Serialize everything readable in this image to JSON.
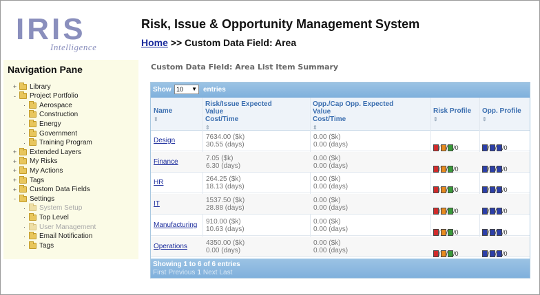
{
  "logo": {
    "name": "IRIS",
    "tagline": "Intelligence"
  },
  "app": {
    "title": "Risk, Issue & Opportunity Management System"
  },
  "breadcrumb": {
    "home": "Home",
    "separator": ">>",
    "current": "Custom Data Field: Area"
  },
  "nav": {
    "title": "Navigation Pane",
    "items": [
      {
        "label": "Library",
        "dim": false
      },
      {
        "label": "Project Portfolio",
        "dim": false
      },
      {
        "label": "Aerospace",
        "dim": false
      },
      {
        "label": "Construction",
        "dim": false
      },
      {
        "label": "Energy",
        "dim": false
      },
      {
        "label": "Government",
        "dim": false
      },
      {
        "label": "Training Program",
        "dim": false
      },
      {
        "label": "Extended Layers",
        "dim": false
      },
      {
        "label": "My Risks",
        "dim": false
      },
      {
        "label": "My Actions",
        "dim": false
      },
      {
        "label": "Tags",
        "dim": false
      },
      {
        "label": "Custom Data Fields",
        "dim": false
      },
      {
        "label": "Settings",
        "dim": false
      },
      {
        "label": "System Setup",
        "dim": true
      },
      {
        "label": "Top Level",
        "dim": false
      },
      {
        "label": "User Management",
        "dim": true
      },
      {
        "label": "Email Notification",
        "dim": false
      },
      {
        "label": "Tags",
        "dim": false
      }
    ]
  },
  "summary": {
    "title": "Custom Data Field: Area List Item Summary"
  },
  "table": {
    "show_label": "Show",
    "page_size": "10",
    "entries_label": "entries",
    "headers": {
      "name": "Name",
      "risk_line1": "Risk/Issue Expected",
      "risk_line2": "Value",
      "risk_line3": "Cost/Time",
      "opp_line1": "Opp./Cap Opp. Expected",
      "opp_line2": "Value",
      "opp_line3": "Cost/Time",
      "risk_profile": "Risk Profile",
      "opp_profile": "Opp. Profile"
    },
    "rows": [
      {
        "name": "Design",
        "risk_cost": "7634.00 ($k)",
        "risk_time": "30.55 (days)",
        "opp_cost": "0.00 ($k)",
        "opp_time": "0.00 (days)",
        "risk_profile": [
          {
            "c": "red",
            "v": "3"
          },
          {
            "c": "orange",
            "v": "3"
          },
          {
            "c": "green",
            "v": "1"
          }
        ],
        "risk_tail": "0",
        "opp_profile": [
          {
            "c": "blue",
            "v": "0"
          },
          {
            "c": "blue",
            "v": "2"
          },
          {
            "c": "blue",
            "v": "0"
          }
        ],
        "opp_tail": "0"
      },
      {
        "name": "Finance",
        "risk_cost": "7.05 ($k)",
        "risk_time": "6.30 (days)",
        "opp_cost": "0.00 ($k)",
        "opp_time": "0.00 (days)",
        "risk_profile": [
          {
            "c": "red",
            "v": "1"
          },
          {
            "c": "orange",
            "v": "1"
          },
          {
            "c": "green",
            "v": "0"
          }
        ],
        "risk_tail": "0",
        "opp_profile": [
          {
            "c": "blue",
            "v": "0"
          },
          {
            "c": "blue",
            "v": "0"
          },
          {
            "c": "blue",
            "v": "0"
          }
        ],
        "opp_tail": "0"
      },
      {
        "name": "HR",
        "risk_cost": "264.25 ($k)",
        "risk_time": "18.13 (days)",
        "opp_cost": "0.00 ($k)",
        "opp_time": "0.00 (days)",
        "risk_profile": [
          {
            "c": "red",
            "v": "1"
          },
          {
            "c": "orange",
            "v": "1"
          },
          {
            "c": "green",
            "v": "1"
          }
        ],
        "risk_tail": "0",
        "opp_profile": [
          {
            "c": "blue",
            "v": "0"
          },
          {
            "c": "blue",
            "v": "1"
          },
          {
            "c": "blue",
            "v": "0"
          }
        ],
        "opp_tail": "0"
      },
      {
        "name": "IT",
        "risk_cost": "1537.50 ($k)",
        "risk_time": "28.88 (days)",
        "opp_cost": "0.00 ($k)",
        "opp_time": "0.00 (days)",
        "risk_profile": [
          {
            "c": "red",
            "v": "3"
          },
          {
            "c": "orange",
            "v": "0"
          },
          {
            "c": "green",
            "v": "0"
          }
        ],
        "risk_tail": "0",
        "opp_profile": [
          {
            "c": "blue",
            "v": "0"
          },
          {
            "c": "blue",
            "v": "1"
          },
          {
            "c": "blue",
            "v": "0"
          }
        ],
        "opp_tail": "0"
      },
      {
        "name": "Manufacturing",
        "risk_cost": "910.00 ($k)",
        "risk_time": "10.63 (days)",
        "opp_cost": "0.00 ($k)",
        "opp_time": "0.00 (days)",
        "risk_profile": [
          {
            "c": "red",
            "v": "1"
          },
          {
            "c": "orange",
            "v": "1"
          },
          {
            "c": "green",
            "v": "2"
          }
        ],
        "risk_tail": "0",
        "opp_profile": [
          {
            "c": "blue",
            "v": "0"
          },
          {
            "c": "blue",
            "v": "2"
          },
          {
            "c": "blue",
            "v": "0"
          }
        ],
        "opp_tail": "0"
      },
      {
        "name": "Operations",
        "risk_cost": "4350.00 ($k)",
        "risk_time": "0.00 (days)",
        "opp_cost": "0.00 ($k)",
        "opp_time": "0.00 (days)",
        "risk_profile": [
          {
            "c": "red",
            "v": "2"
          },
          {
            "c": "orange",
            "v": "2"
          },
          {
            "c": "green",
            "v": "0"
          }
        ],
        "risk_tail": "0",
        "opp_profile": [
          {
            "c": "blue",
            "v": "0"
          },
          {
            "c": "blue",
            "v": "2"
          },
          {
            "c": "blue",
            "v": "0"
          }
        ],
        "opp_tail": "0"
      }
    ],
    "info": "Showing 1 to 6 of 6 entries",
    "pager": {
      "first": "First",
      "previous": "Previous",
      "page": "1",
      "next": "Next",
      "last": "Last"
    },
    "sort_icon": "⇕"
  },
  "colors": {
    "brand": "#8a8fbd",
    "link": "#1a2b9c",
    "header_bar": "#8fbae0",
    "nav_bg": "#fbfbe6"
  }
}
